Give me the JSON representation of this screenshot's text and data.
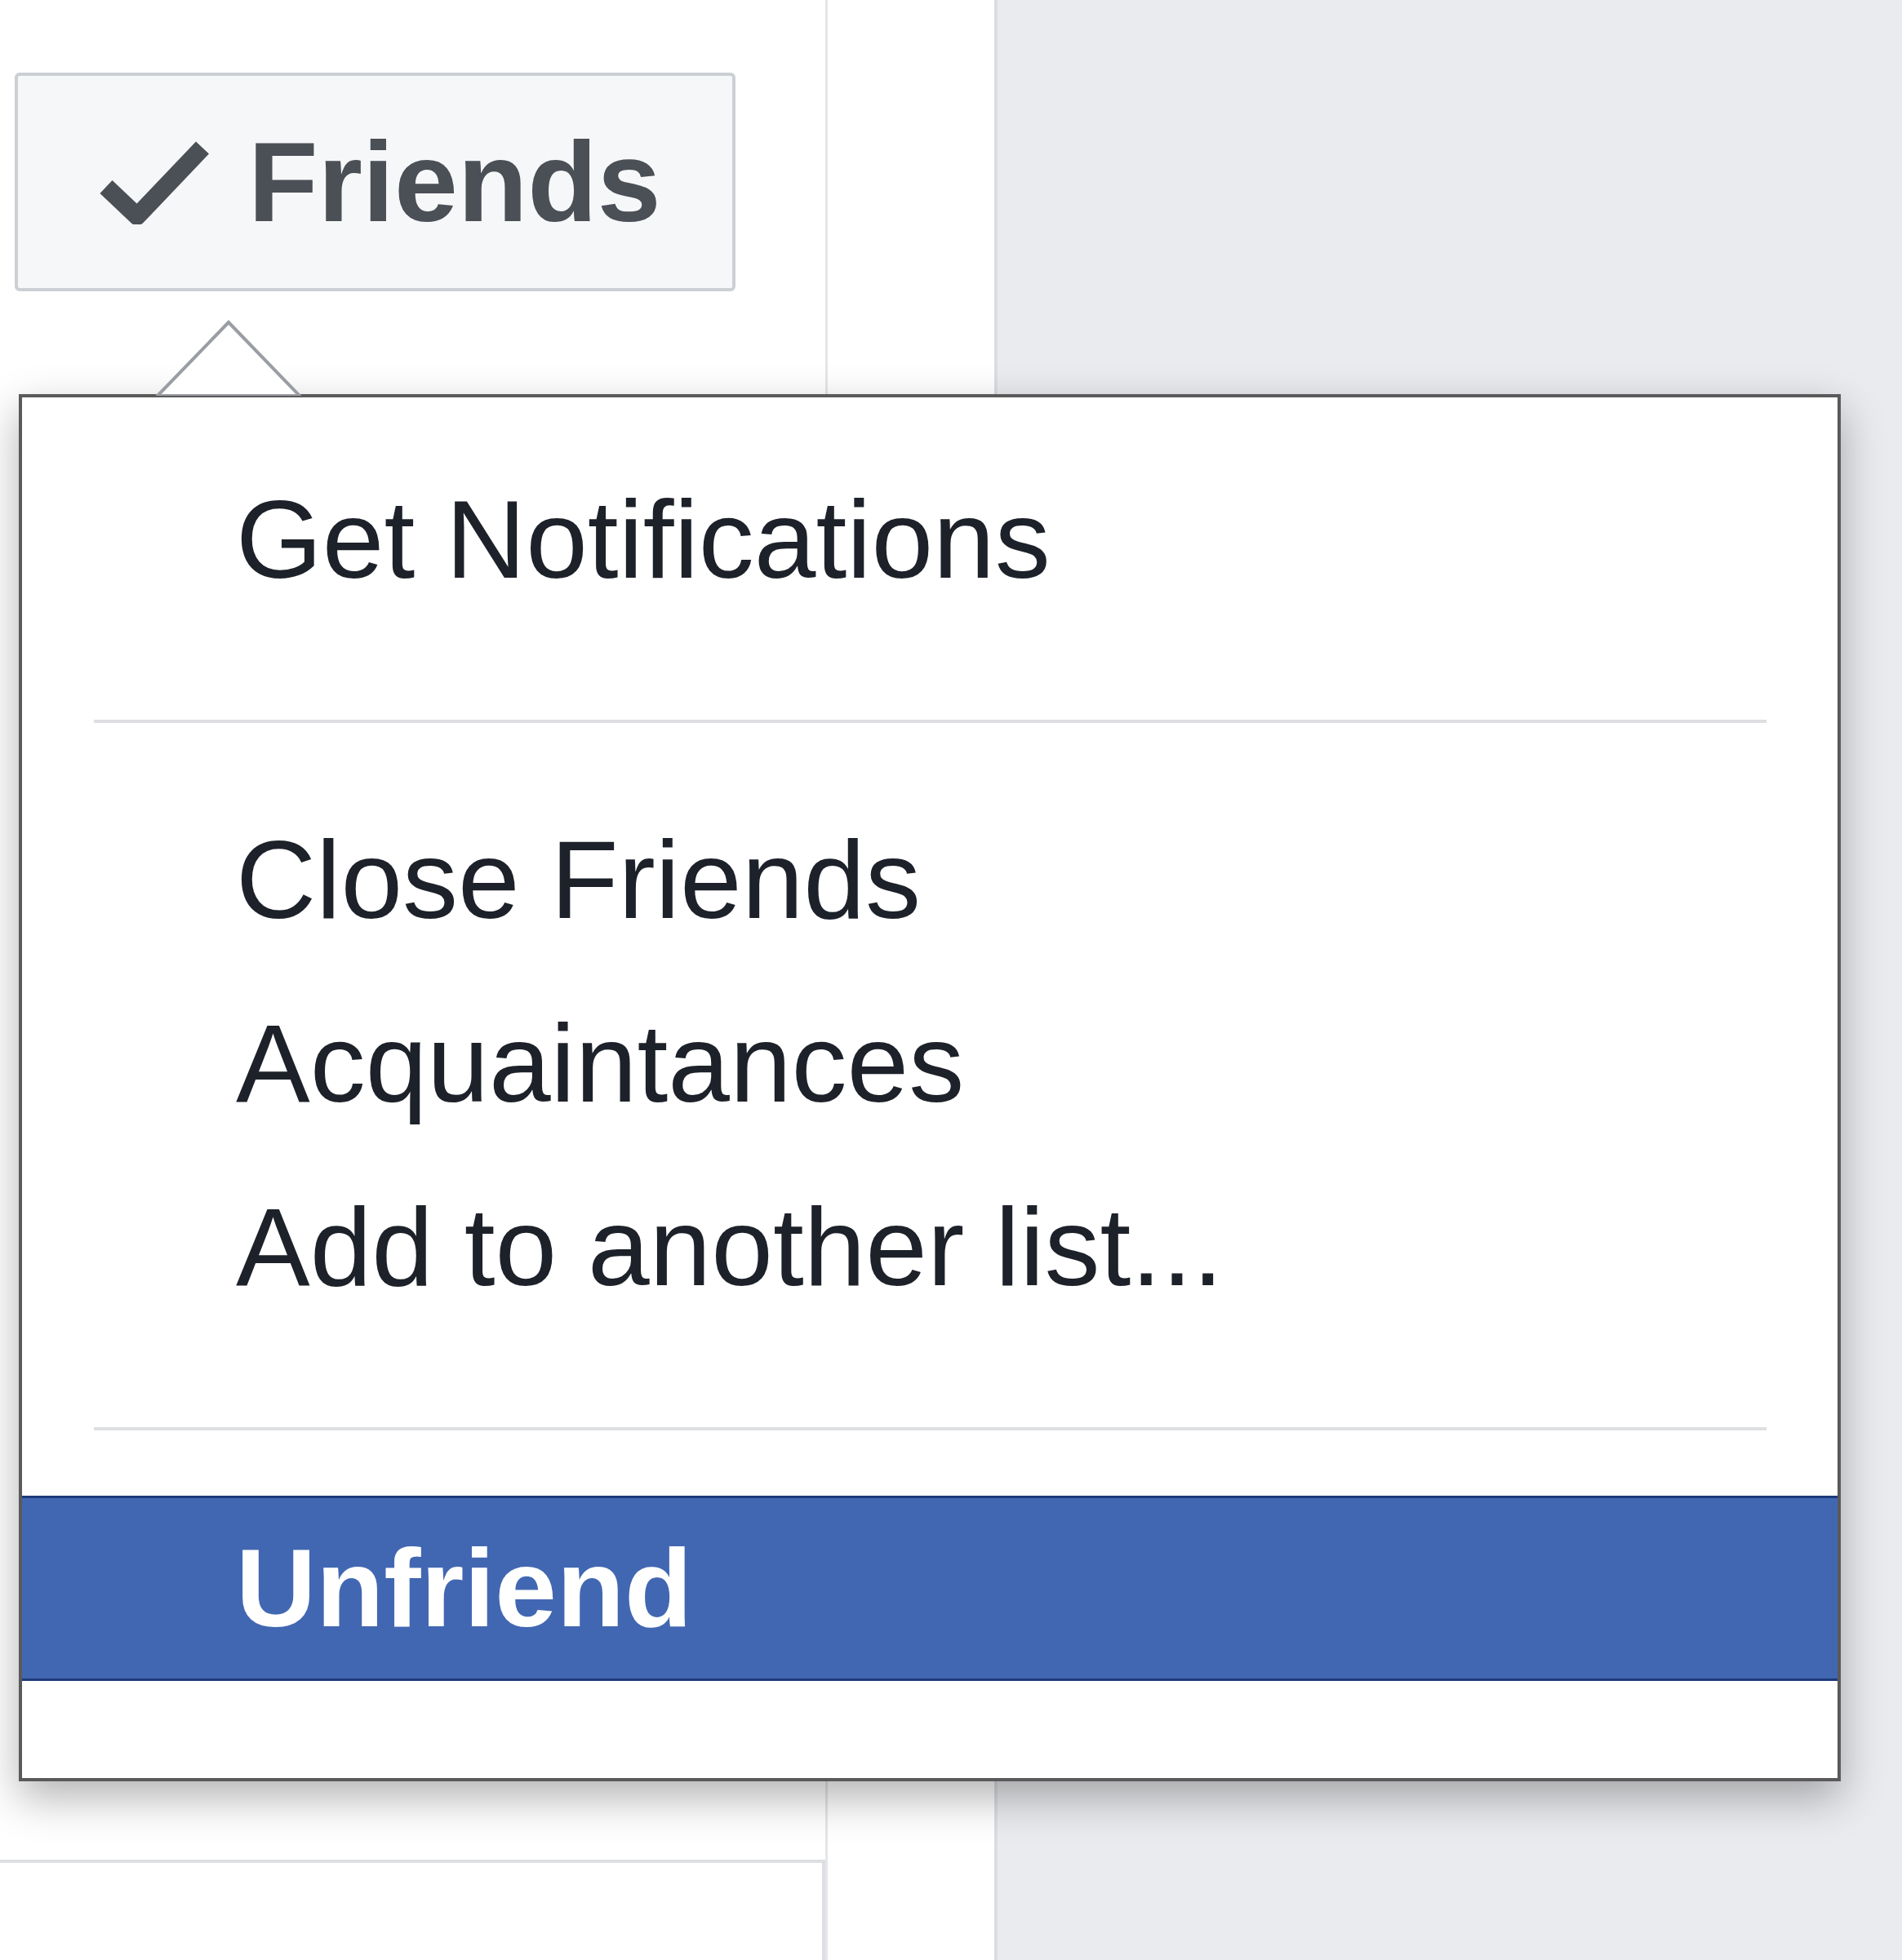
{
  "friends_button": {
    "label": "Friends",
    "checked": true
  },
  "menu": {
    "sections": [
      {
        "items": [
          {
            "label": "Get Notifications",
            "selected": false
          }
        ]
      },
      {
        "items": [
          {
            "label": "Close Friends",
            "selected": false
          },
          {
            "label": "Acquaintances",
            "selected": false
          },
          {
            "label": "Add to another list...",
            "selected": false
          }
        ]
      },
      {
        "items": [
          {
            "label": "Unfriend",
            "selected": true
          }
        ]
      }
    ]
  }
}
